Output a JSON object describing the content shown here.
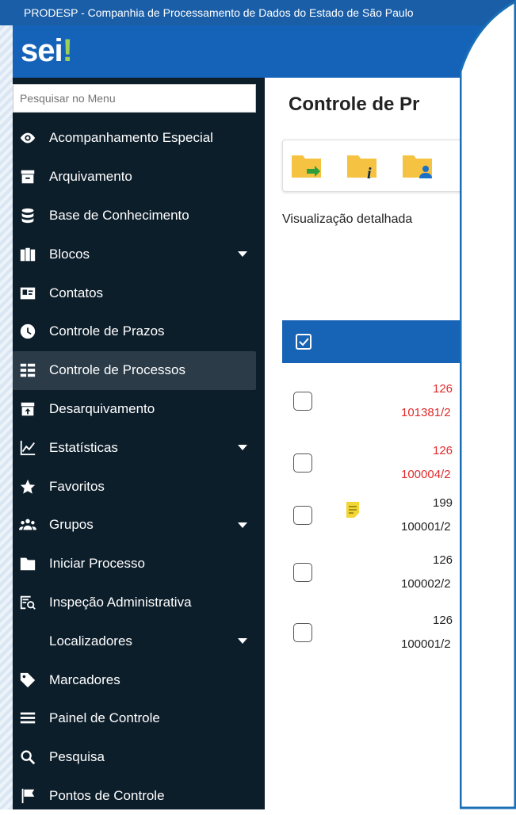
{
  "top_bar": {
    "title": "PRODESP - Companhia de Processamento de Dados do Estado de São Paulo"
  },
  "logo": {
    "text": "sei",
    "mark": "!"
  },
  "sidebar": {
    "search_placeholder": "Pesquisar no Menu",
    "items": [
      {
        "label": "Acompanhamento Especial",
        "icon": "eye-icon"
      },
      {
        "label": "Arquivamento",
        "icon": "archive-icon"
      },
      {
        "label": "Base de Conhecimento",
        "icon": "database-icon"
      },
      {
        "label": "Blocos",
        "icon": "blocks-icon",
        "expandable": true
      },
      {
        "label": "Contatos",
        "icon": "contact-card-icon"
      },
      {
        "label": "Controle de Prazos",
        "icon": "clock-icon"
      },
      {
        "label": "Controle de Processos",
        "icon": "list-icon",
        "active": true
      },
      {
        "label": "Desarquivamento",
        "icon": "unarchive-icon"
      },
      {
        "label": "Estatísticas",
        "icon": "chart-line-icon",
        "expandable": true
      },
      {
        "label": "Favoritos",
        "icon": "star-icon"
      },
      {
        "label": "Grupos",
        "icon": "users-icon",
        "expandable": true
      },
      {
        "label": "Iniciar Processo",
        "icon": "folder-icon"
      },
      {
        "label": "Inspeção Administrativa",
        "icon": "inspection-icon"
      },
      {
        "label": "Localizadores",
        "icon": "",
        "expandable": true
      },
      {
        "label": "Marcadores",
        "icon": "tag-icon"
      },
      {
        "label": "Painel de Controle",
        "icon": "menu-lines-icon"
      },
      {
        "label": "Pesquisa",
        "icon": "search-icon"
      },
      {
        "label": "Pontos de Controle",
        "icon": "flag-icon"
      }
    ]
  },
  "main": {
    "title": "Controle de Pr",
    "toolbar_icons": [
      "folder-send-icon",
      "folder-info-icon",
      "folder-user-icon"
    ],
    "view_label": "Visualização detalhada",
    "rows": [
      {
        "num1": "126",
        "num2": "101381/2",
        "color": "#e02b2b",
        "note": false
      },
      {
        "num1": "126",
        "num2": "100004/2",
        "color": "#e02b2b",
        "note": false
      },
      {
        "num1": "199",
        "num2": "100001/2",
        "color": "#222222",
        "note": true
      },
      {
        "num1": "126",
        "num2": "100002/2",
        "color": "#222222",
        "note": false
      },
      {
        "num1": "126",
        "num2": "100001/2",
        "color": "#222222",
        "note": false
      }
    ]
  },
  "colors": {
    "header": "#1563b8",
    "sidebar": "#0d1e2b",
    "table_header": "#1763b5",
    "callout_border": "#1a6fb5"
  }
}
